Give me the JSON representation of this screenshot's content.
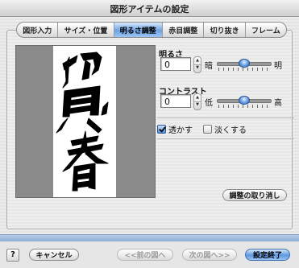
{
  "window": {
    "title": "図形アイテムの設定"
  },
  "tabs": [
    {
      "label": "図形入力",
      "active": false
    },
    {
      "label": "サイズ・位置",
      "active": false
    },
    {
      "label": "明るさ調整",
      "active": true
    },
    {
      "label": "赤目調整",
      "active": false
    },
    {
      "label": "切り抜き",
      "active": false
    },
    {
      "label": "フレーム",
      "active": false
    }
  ],
  "brightness": {
    "label": "明るさ",
    "value": "0",
    "low_label": "暗",
    "high_label": "明",
    "slider_fraction": 0.5
  },
  "contrast": {
    "label": "コントラスト",
    "value": "0",
    "low_label": "低",
    "high_label": "高",
    "slider_fraction": 0.5
  },
  "options": {
    "transparent": {
      "label": "透かす",
      "checked": true
    },
    "lighten": {
      "label": "淡くする",
      "checked": false
    }
  },
  "buttons": {
    "reset": "調整の取り消し",
    "help": "?",
    "cancel": "キャンセル",
    "prev": "<<前の図へ",
    "next": "次の図へ>>",
    "finish": "設定終了"
  },
  "icons": {
    "stepper_up": "up-arrow",
    "stepper_down": "down-arrow",
    "checkmark": "check"
  },
  "colors": {
    "accent": "#5e97df",
    "preview_background": "#8a8a8a"
  }
}
